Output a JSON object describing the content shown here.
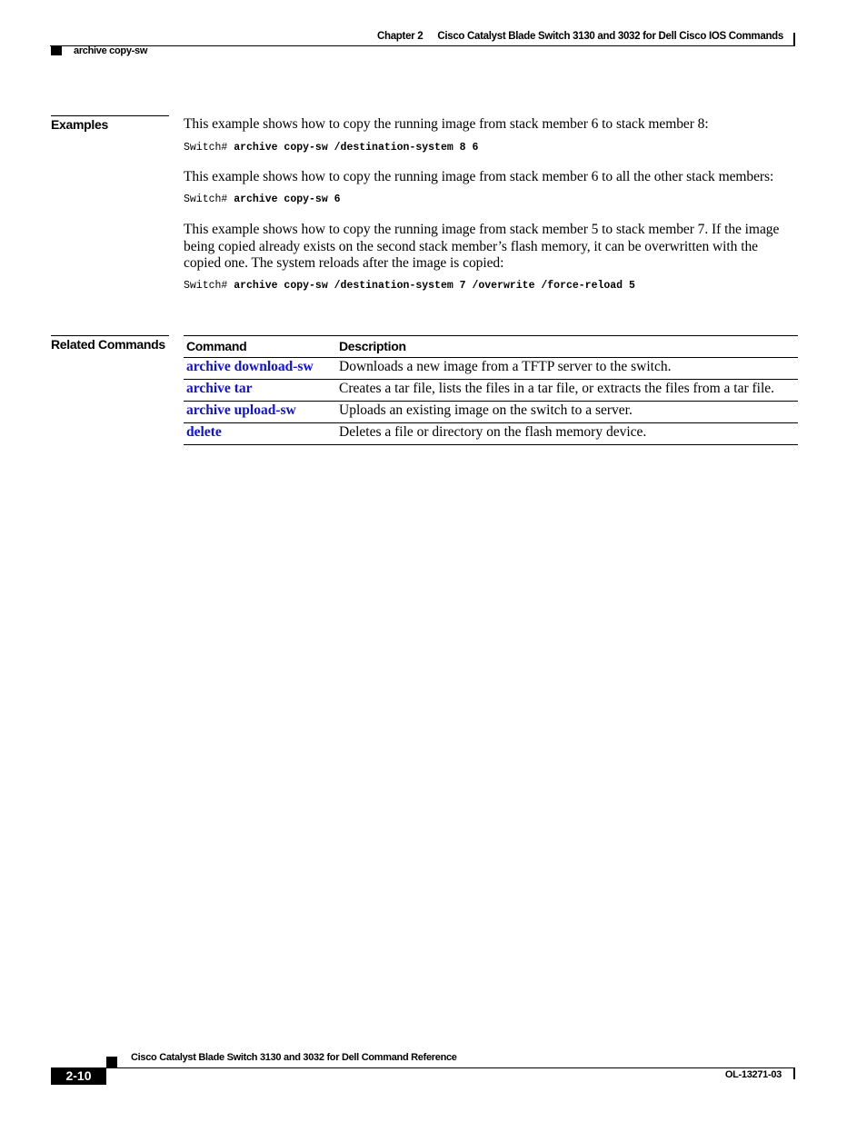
{
  "header": {
    "chapter_label": "Chapter 2",
    "chapter_title": "Cisco Catalyst Blade Switch 3130 and 3032 for Dell Cisco IOS Commands",
    "section_name": "archive copy-sw"
  },
  "examples": {
    "heading": "Examples",
    "items": [
      {
        "description": "This example shows how to copy the running image from stack member 6 to stack member 8:",
        "prompt": "Switch#",
        "command": "archive copy-sw /destination-system 8 6"
      },
      {
        "description": "This example shows how to copy the running image from stack member 6 to all the other stack members:",
        "prompt": "Switch#",
        "command": "archive copy-sw 6"
      },
      {
        "description": "This example shows how to copy the running image from stack member 5 to stack member 7. If the image being copied already exists on the second stack member’s flash memory, it can be overwritten with the copied one. The system reloads after the image is copied:",
        "prompt": "Switch#",
        "command": "archive copy-sw /destination-system 7 /overwrite /force-reload 5"
      }
    ]
  },
  "related_commands": {
    "heading": "Related Commands",
    "columns": [
      "Command",
      "Description"
    ],
    "link_color": "#1010e0",
    "rows": [
      {
        "command": "archive download-sw",
        "description": "Downloads a new image from a TFTP server to the switch."
      },
      {
        "command": "archive tar",
        "description": "Creates a tar file, lists the files in a tar file, or extracts the files from a tar file."
      },
      {
        "command": "archive upload-sw",
        "description": "Uploads an existing image on the switch to a server."
      },
      {
        "command": "delete",
        "description": "Deletes a file or directory on the flash memory device."
      }
    ]
  },
  "footer": {
    "book_title": "Cisco Catalyst Blade Switch 3130 and 3032 for Dell Command Reference",
    "page_number": "2-10",
    "doc_id": "OL-13271-03"
  }
}
